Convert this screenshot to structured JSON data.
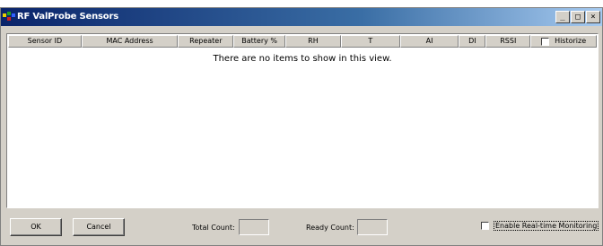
{
  "window": {
    "title": "RF ValProbe Sensors"
  },
  "caption_buttons": {
    "minimize": "_",
    "maximize": "□",
    "close": "×"
  },
  "columns": [
    "Sensor ID",
    "MAC Address",
    "Repeater",
    "Battery %",
    "RH",
    "T",
    "AI",
    "DI",
    "RSSI",
    "Historize"
  ],
  "empty_message": "There are no items to show in this view.",
  "footer": {
    "ok_label": "OK",
    "cancel_label": "Cancel",
    "total_count_label": "Total Count:",
    "total_count_value": "",
    "ready_count_label": "Ready Count:",
    "ready_count_value": "",
    "realtime_label": "Enable Real-time Monitoring",
    "realtime_checked": false,
    "historize_checked": false
  },
  "colors": {
    "titlebar_start": "#0a246a",
    "titlebar_end": "#a6caf0",
    "face": "#d4d0c8"
  }
}
